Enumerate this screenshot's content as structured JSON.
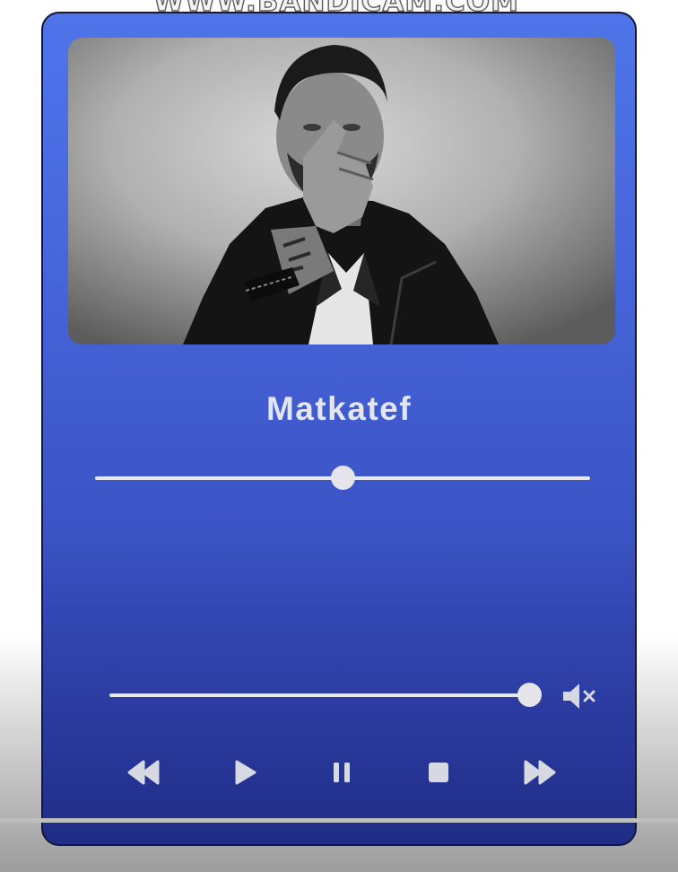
{
  "watermark": "WWW.BANDICAM.COM",
  "player": {
    "cover_art": "artist-portrait",
    "title": "Matkatef",
    "seek": {
      "position_fraction": 0.5
    },
    "volume": {
      "level_fraction": 1.0
    },
    "controls": {
      "rewind": "rewind-icon",
      "play": "play-icon",
      "pause": "pause-icon",
      "stop": "stop-icon",
      "fast_forward": "fast-forward-icon",
      "mute": "volume-mute-icon"
    },
    "colors": {
      "card_top": "#4f74ea",
      "card_bottom": "#202d86",
      "control": "#d6d8e2"
    }
  }
}
